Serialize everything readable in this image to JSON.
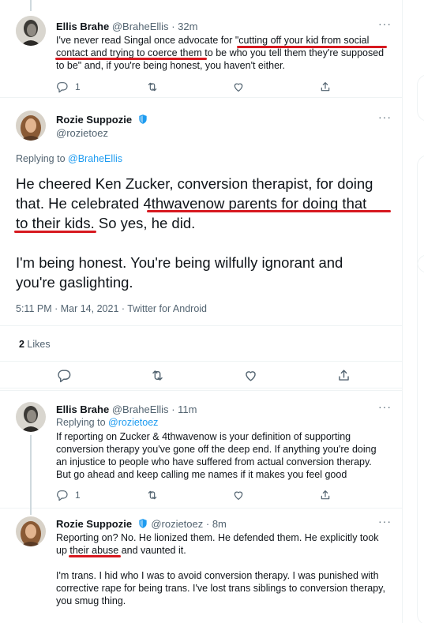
{
  "tweets": {
    "t1": {
      "name": "Ellis Brahe",
      "handle": "@BraheEllis",
      "time": "· 32m",
      "line1": "I've never read Singal once advocate for \"cutting off your kid from social",
      "line2": "contact and trying to coerce them to be who you tell them they're supposed",
      "line3": "to be\" and, if you're being honest, you haven't either.",
      "reply_count": "1"
    },
    "main": {
      "name": "Rozie Suppozie",
      "handle": "@rozietoez",
      "replying_prefix": "Replying to ",
      "replying_to": "@BraheEllis",
      "line1": "He cheered Ken Zucker, conversion therapist, for doing",
      "line2": "that. He celebrated 4thwavenow parents for doing that",
      "line3": "to their kids. So yes, he did.",
      "line4": "I'm being honest. You're being wilfully ignorant and",
      "line5": "you're gaslighting.",
      "timestamp": "5:11 PM · Mar 14, 2021 · Twitter for Android",
      "likes_count": "2",
      "likes_label": " Likes"
    },
    "t3": {
      "name": "Ellis Brahe",
      "handle": "@BraheEllis",
      "time": "· 11m",
      "replying_prefix": "Replying to ",
      "replying_to": "@rozietoez",
      "line1": "If reporting on Zucker & 4thwavenow is your definition of supporting",
      "line2": "conversion therapy you've gone off the deep end. If anything you're doing",
      "line3": "an injustice to people who have suffered from actual conversion therapy.",
      "line4": "But go ahead and keep calling me names if it makes you feel good",
      "reply_count": "1"
    },
    "t4": {
      "name": "Rozie Suppozie",
      "handle": "@rozietoez",
      "time": "· 8m",
      "line1": "Reporting on? No. He lionized them. He defended them. He explicitly took",
      "line2": "up their abuse and vaunted it.",
      "line3": "I'm trans. I hid who I was to avoid conversion therapy. I was punished with",
      "line4": "corrective rape for being trans. I've lost trans siblings to conversion therapy,",
      "line5": "you smug thing."
    }
  },
  "icons": {
    "reply": "reply-icon",
    "retweet": "retweet-icon",
    "like": "heart-icon",
    "share": "share-icon",
    "more": "more-icon",
    "verified": "verified-badge-icon"
  },
  "colors": {
    "annotation_underline": "#d71920",
    "link": "#1d9bf0",
    "secondary_text": "#536471",
    "verified": "#1d9bf0"
  }
}
